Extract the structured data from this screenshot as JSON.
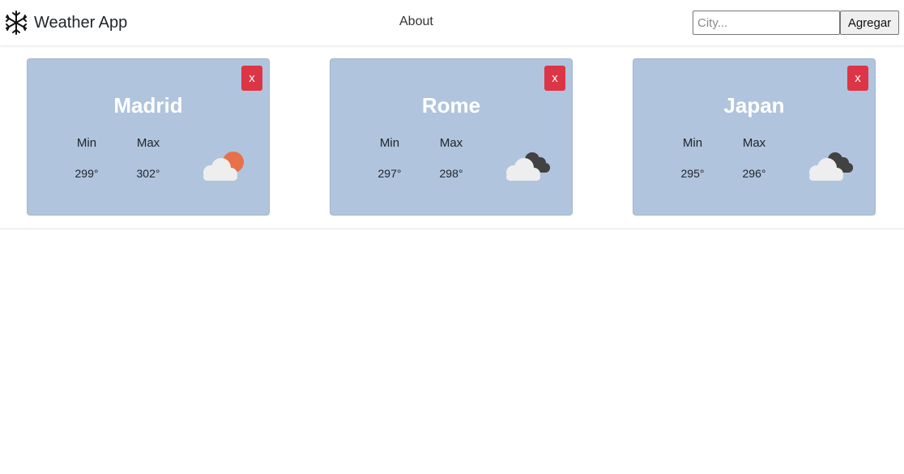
{
  "navbar": {
    "brand_icon": "snowflake-icon",
    "brand_title": "Weather App",
    "about_label": "About",
    "search": {
      "placeholder": "City...",
      "value": ""
    },
    "add_button_label": "Agregar"
  },
  "cards": [
    {
      "city": "Madrid",
      "close_label": "x",
      "min_label": "Min",
      "max_label": "Max",
      "min_value": "299°",
      "max_value": "302°",
      "weather_icon": "partly-cloudy-sun-icon"
    },
    {
      "city": "Rome",
      "close_label": "x",
      "min_label": "Min",
      "max_label": "Max",
      "min_value": "297°",
      "max_value": "298°",
      "weather_icon": "broken-clouds-icon"
    },
    {
      "city": "Japan",
      "close_label": "x",
      "min_label": "Min",
      "max_label": "Max",
      "min_value": "295°",
      "max_value": "296°",
      "weather_icon": "broken-clouds-icon"
    }
  ],
  "colors": {
    "card_background": "#b0c4de",
    "close_button": "#dc3545",
    "sun": "#e8704a",
    "dark_cloud": "#424242",
    "light_cloud": "#eeeeee"
  }
}
